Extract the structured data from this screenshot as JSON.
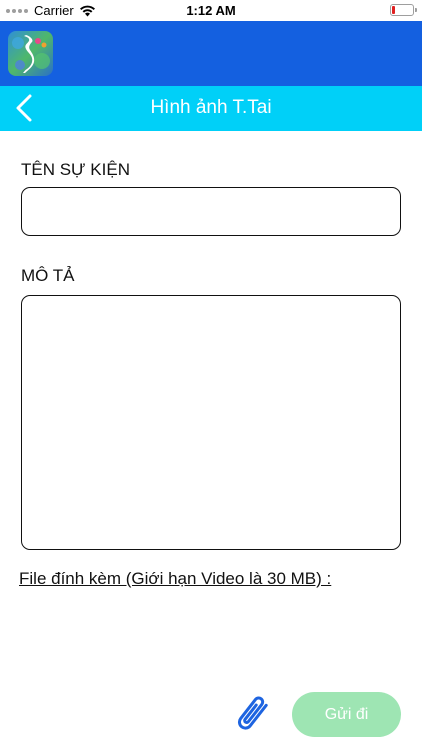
{
  "status_bar": {
    "carrier": "Carrier",
    "time": "1:12 AM",
    "wifi_icon": "wifi-icon",
    "battery_icon": "battery-low-icon",
    "battery_color": "#e02020"
  },
  "header": {
    "logo_icon": "vietnam-map-logo",
    "background_color": "#1460e0"
  },
  "nav": {
    "back_icon": "chevron-left-icon",
    "title": "Hình ảnh T.Tai",
    "background_color": "#00d0f8"
  },
  "form": {
    "event_name_label": "TÊN SỰ KIỆN",
    "event_name_value": "",
    "description_label": "MÔ TẢ",
    "description_value": "",
    "attachment_label": "File đính kèm (Giới hạn Video là 30 MB) :"
  },
  "actions": {
    "attach_icon": "paperclip-icon",
    "send_label": "Gửi đi",
    "send_color": "#9ee5b3"
  }
}
